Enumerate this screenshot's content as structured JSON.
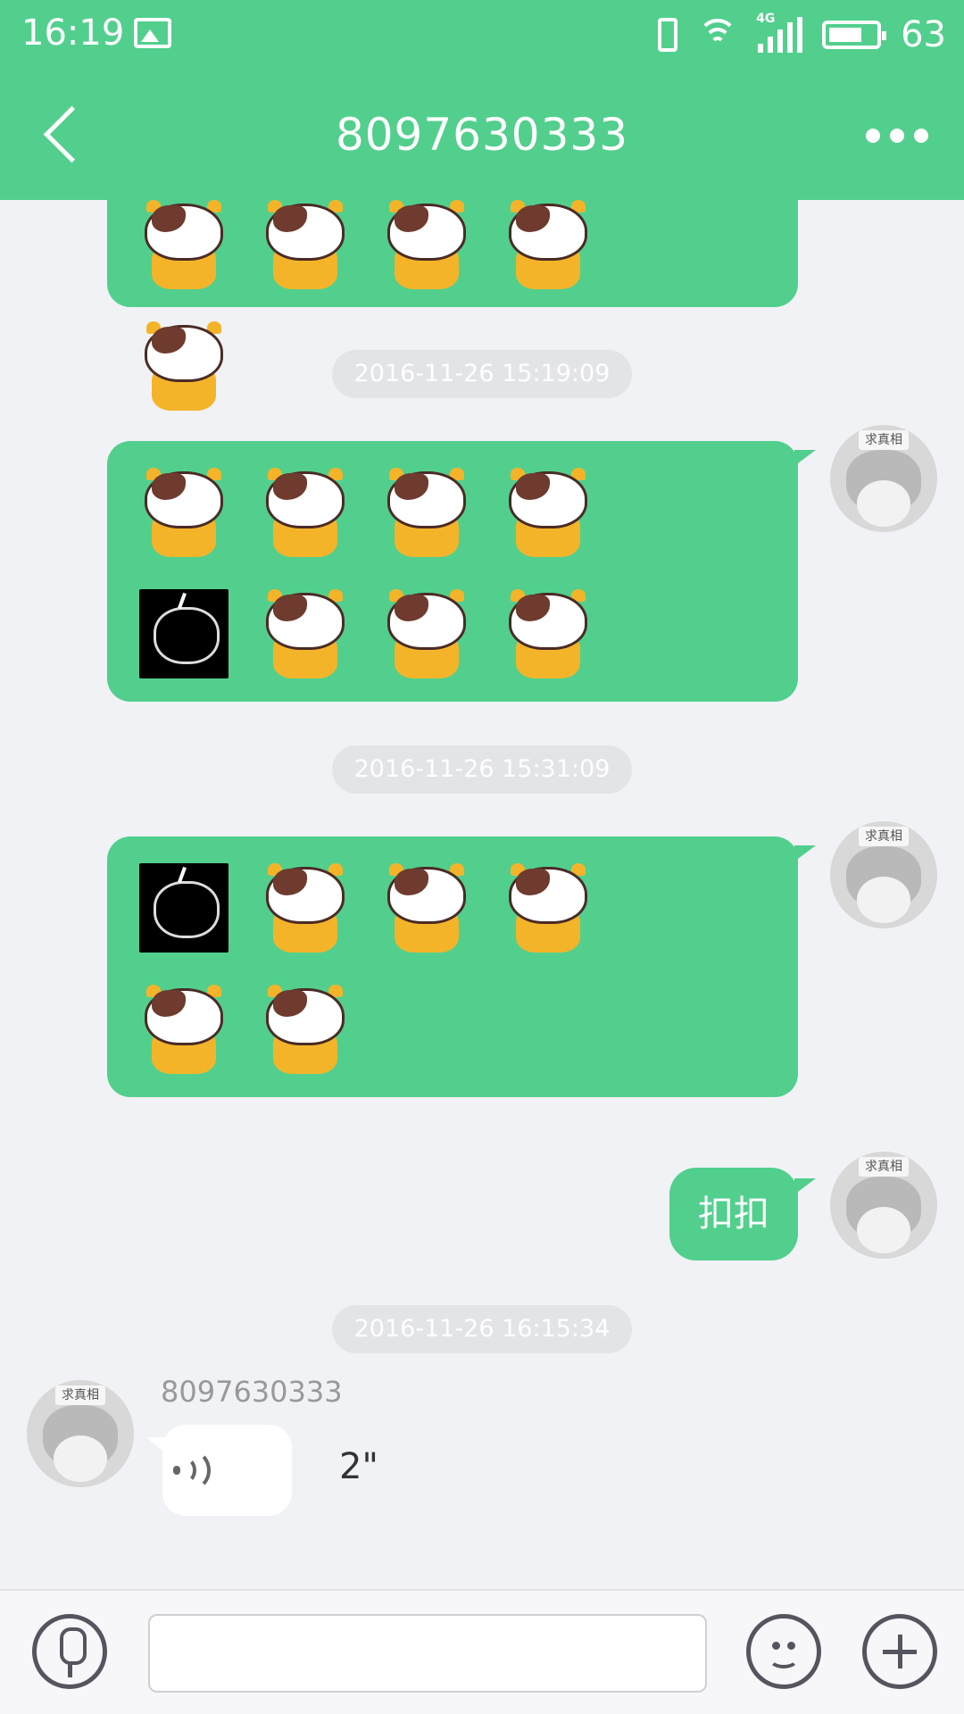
{
  "status_bar": {
    "time": "16:19",
    "battery_level": "63",
    "network_label": "4G"
  },
  "header": {
    "title": "8097630333"
  },
  "messages": [
    {
      "type": "sticker_group",
      "direction": "outgoing",
      "partial": true,
      "stickers": [
        "cow-drink",
        "cow-bye",
        "cow-cry",
        "cow-cry",
        "cow-drink"
      ]
    },
    {
      "type": "timestamp",
      "text": "2016-11-26 15:19:09"
    },
    {
      "type": "sticker_group",
      "direction": "outgoing",
      "stickers": [
        "cow-drink",
        "cow-question",
        "cow-laugh",
        "cow-question",
        "cow-dark",
        "cow-sad",
        "cow-sad",
        "cow-drink"
      ]
    },
    {
      "type": "timestamp",
      "text": "2016-11-26 15:31:09"
    },
    {
      "type": "sticker_group",
      "direction": "outgoing",
      "stickers": [
        "cow-dark",
        "cow-drink",
        "cow-drink",
        "cow-sad",
        "cow-drink",
        "cow-drink"
      ]
    },
    {
      "type": "text",
      "direction": "outgoing",
      "text": "扣扣"
    },
    {
      "type": "timestamp",
      "text": "2016-11-26 16:15:34"
    },
    {
      "type": "voice",
      "direction": "incoming",
      "sender": "8097630333",
      "duration": "2\""
    }
  ],
  "avatar_label": "求真相",
  "input": {
    "value": "",
    "placeholder": ""
  },
  "colors": {
    "accent": "#52cf8d",
    "background": "#f1f2f6",
    "timestamp_bg": "#e3e4e8",
    "icon": "#54555e"
  }
}
